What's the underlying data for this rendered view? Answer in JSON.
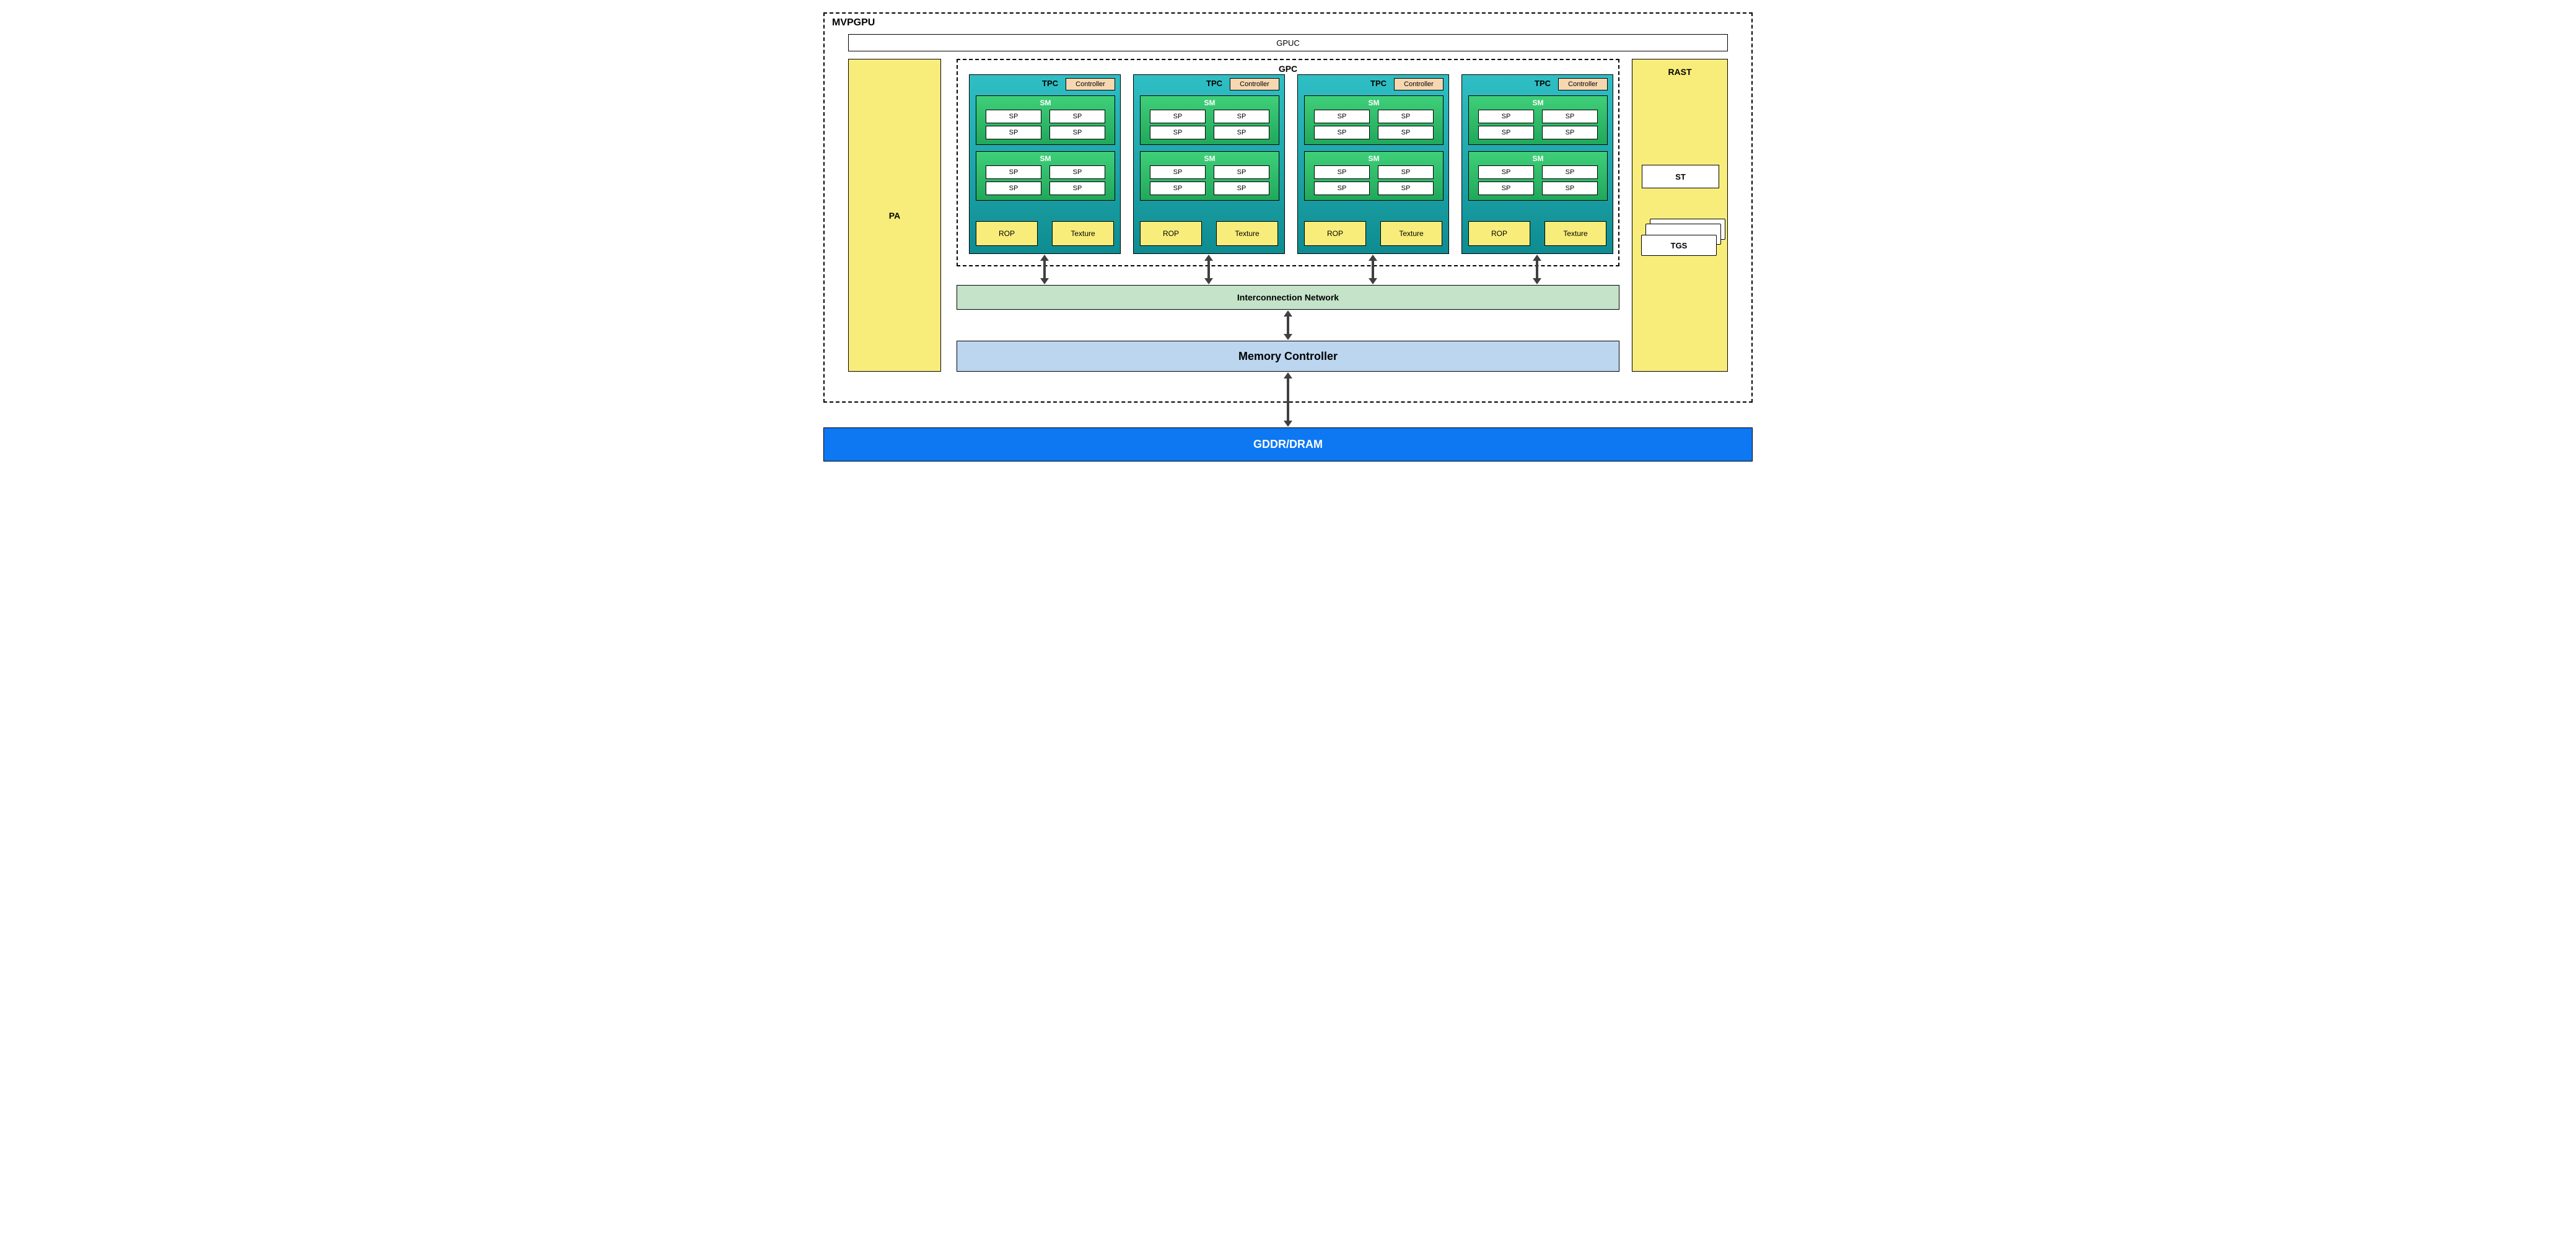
{
  "outer_label": "MVPGPU",
  "gpuc": "GPUC",
  "pa": "PA",
  "gpc_label": "GPC",
  "tpc": {
    "label": "TPC",
    "controller": "Controller",
    "sm_label": "SM",
    "sp": "SP",
    "rop": "ROP",
    "texture": "Texture"
  },
  "rast": {
    "title": "RAST",
    "st": "ST",
    "dots": "...",
    "tgs": "TGS"
  },
  "interconnect": "Interconnection Network",
  "memctrl": "Memory Controller",
  "dram": "GDDR/DRAM"
}
